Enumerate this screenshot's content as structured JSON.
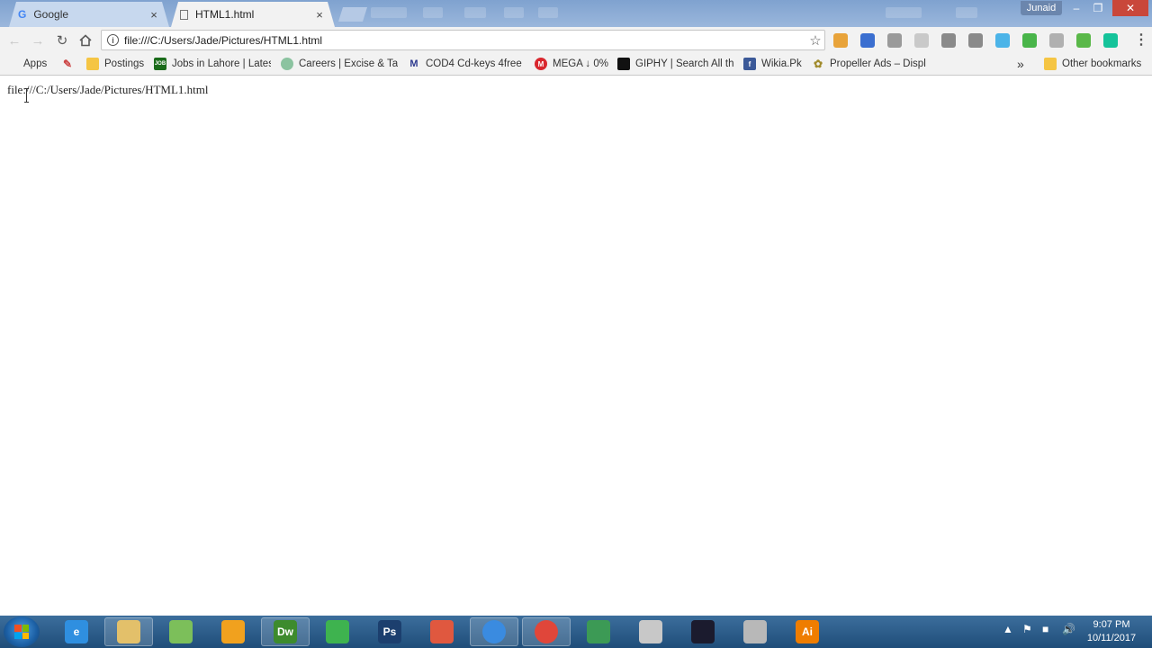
{
  "tabs": [
    {
      "title": "Google",
      "icon": "google-icon",
      "close": "×"
    },
    {
      "title": "HTML1.html",
      "icon": "page-icon",
      "close": "×"
    }
  ],
  "window": {
    "user": "Junaid"
  },
  "toolbar": {
    "url": "file:///C:/Users/Jade/Pictures/HTML1.html",
    "star": "☆"
  },
  "extensions": [
    {
      "name": "honey-extension-icon",
      "color": "#e8a33a"
    },
    {
      "name": "a-extension-icon",
      "color": "#3b6fd0"
    },
    {
      "name": "gray-extension-icon",
      "color": "#9a9a9a"
    },
    {
      "name": "pen-extension-icon",
      "color": "#c9c9c9"
    },
    {
      "name": "camera-extension-icon",
      "color": "#8a8a8a"
    },
    {
      "name": "check-extension-icon",
      "color": "#8a8a8a"
    },
    {
      "name": "colorful-extension-icon",
      "color": "#4cb4e8"
    },
    {
      "name": "power-extension-icon",
      "color": "#49b54a"
    },
    {
      "name": "shield-extension-icon",
      "color": "#b0b0b0"
    },
    {
      "name": "green-extension-icon",
      "color": "#5ab849"
    },
    {
      "name": "grammarly-extension-icon",
      "color": "#15c39a"
    }
  ],
  "bookmarks": {
    "apps": "Apps",
    "items": [
      {
        "label": "Postings",
        "icon": "folder-icon"
      },
      {
        "label": "Jobs in Lahore | Lates",
        "icon": "jobz-icon"
      },
      {
        "label": "Careers | Excise & Ta",
        "icon": "careers-icon"
      },
      {
        "label": "COD4 Cd-keys 4free",
        "icon": "m-icon"
      },
      {
        "label": "MEGA ↓ 0%",
        "icon": "mega-icon"
      },
      {
        "label": "GIPHY | Search All th",
        "icon": "giphy-icon"
      },
      {
        "label": "Wikia.Pk",
        "icon": "facebook-icon"
      },
      {
        "label": "Propeller Ads – Displ",
        "icon": "propeller-icon"
      }
    ],
    "more": "»",
    "other": "Other bookmarks"
  },
  "page": {
    "text": "file:///C:/Users/Jade/Pictures/HTML1.html"
  },
  "taskbar": {
    "apps": [
      {
        "name": "ie-taskbar-icon",
        "label": "e",
        "color": "#2f8fe0"
      },
      {
        "name": "explorer-taskbar-icon",
        "label": "",
        "color": "#e3c06a"
      },
      {
        "name": "android-studio-taskbar-icon",
        "label": "",
        "color": "#7cbf5a"
      },
      {
        "name": "audacity-taskbar-icon",
        "label": "",
        "color": "#f1a11e"
      },
      {
        "name": "dreamweaver-taskbar-icon",
        "label": "Dw",
        "color": "#3d8b2d"
      },
      {
        "name": "camtasia-taskbar-icon",
        "label": "",
        "color": "#3eb34f"
      },
      {
        "name": "photoshop-taskbar-icon",
        "label": "Ps",
        "color": "#1c3f6e"
      },
      {
        "name": "red-app-taskbar-icon",
        "label": "",
        "color": "#e0583f"
      },
      {
        "name": "chrome-user-taskbar-icon",
        "label": "",
        "color": "#3a8be0"
      },
      {
        "name": "chrome-taskbar-icon",
        "label": "",
        "color": "#e0463a"
      },
      {
        "name": "globe-taskbar-icon",
        "label": "",
        "color": "#3c9a55"
      },
      {
        "name": "tools-taskbar-icon",
        "label": "",
        "color": "#c8c8c8"
      },
      {
        "name": "visual-studio-taskbar-icon",
        "label": "",
        "color": "#1b1b2e"
      },
      {
        "name": "settings-taskbar-icon",
        "label": "",
        "color": "#b8b8b8"
      },
      {
        "name": "illustrator-taskbar-icon",
        "label": "Ai",
        "color": "#ef7d00"
      }
    ],
    "clock": {
      "time": "9:07 PM",
      "date": "10/11/2017"
    }
  }
}
